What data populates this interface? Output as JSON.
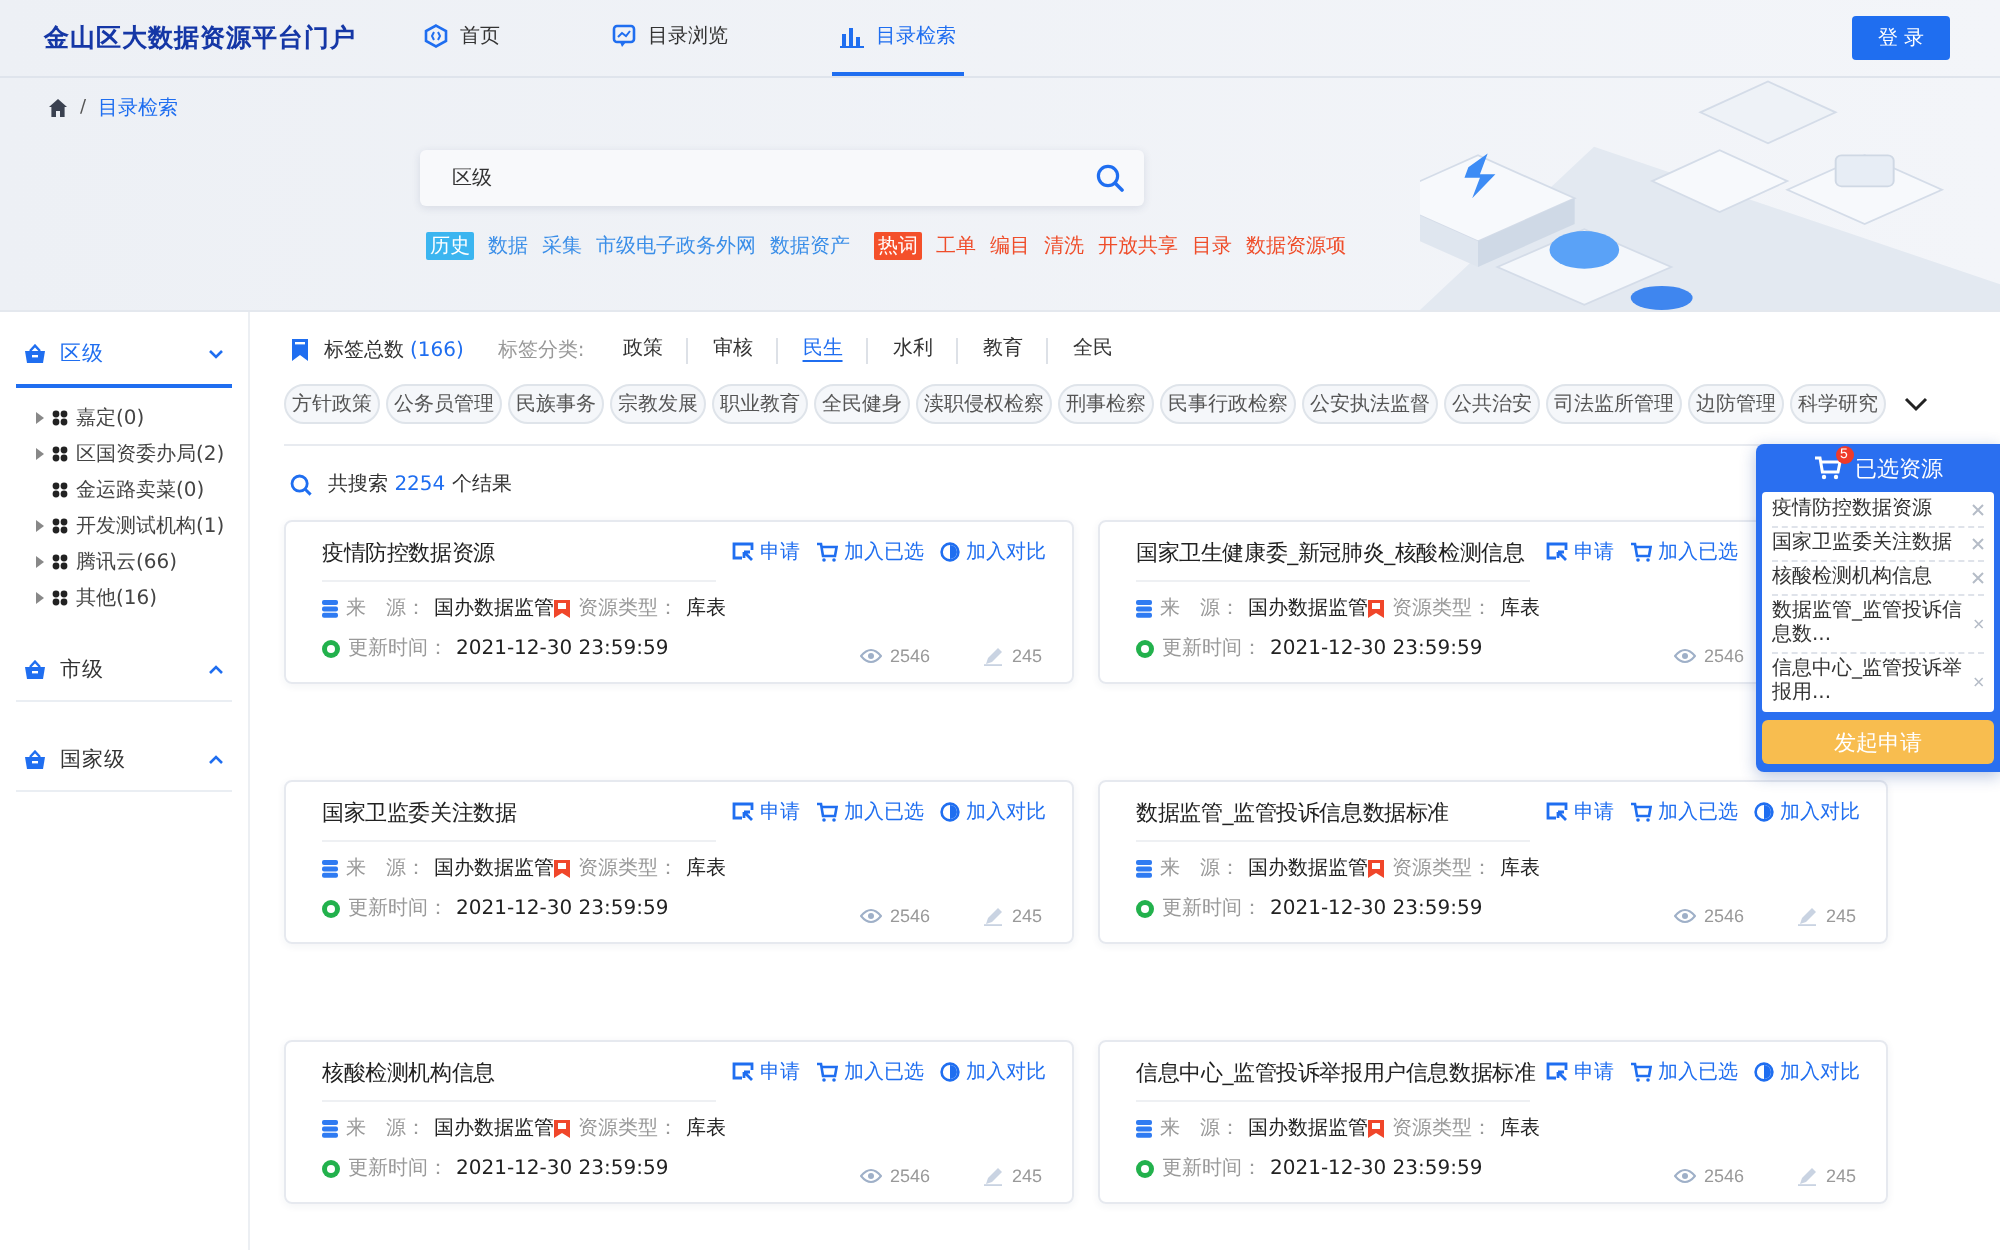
{
  "header": {
    "title": "金山区大数据资源平台门户",
    "nav": [
      {
        "kind": "home",
        "label": "首页",
        "selected": false
      },
      {
        "kind": "browse",
        "label": "目录浏览",
        "selected": false
      },
      {
        "kind": "search",
        "label": "目录检索",
        "selected": true
      }
    ],
    "login": "登 录"
  },
  "breadcrumb": {
    "separator": "/",
    "current": "目录检索"
  },
  "search": {
    "value": "区级"
  },
  "keywords": [
    {
      "kind": "history",
      "label": "历史",
      "items": [
        "数据",
        "采集",
        "市级电子政务外网",
        "数据资产"
      ]
    },
    {
      "kind": "hot",
      "label": "热词",
      "items": [
        "工单",
        "编目",
        "清洗",
        "开放共享",
        "目录",
        "数据资源项"
      ]
    }
  ],
  "sidebar": [
    {
      "label": "区级",
      "selected": true,
      "expanded": true,
      "children": [
        {
          "label": "嘉定(0)",
          "expandable": true
        },
        {
          "label": "区国资委办局(2)",
          "expandable": true
        },
        {
          "label": "金运路卖菜(0)",
          "expandable": false
        },
        {
          "label": "开发测试机构(1)",
          "expandable": true
        },
        {
          "label": "腾讯云(66)",
          "expandable": true
        },
        {
          "label": "其他(16)",
          "expandable": true
        }
      ]
    },
    {
      "label": "市级",
      "selected": false,
      "expanded": false
    },
    {
      "label": "国家级",
      "selected": false,
      "expanded": false
    }
  ],
  "tags": {
    "total_label": "标签总数",
    "total": "(166)",
    "category_label": "标签分类:",
    "categories": [
      {
        "label": "政策",
        "selected": false
      },
      {
        "label": "审核",
        "selected": false
      },
      {
        "label": "民生",
        "selected": true
      },
      {
        "label": "水利",
        "selected": false
      },
      {
        "label": "教育",
        "selected": false
      },
      {
        "label": "全民",
        "selected": false
      }
    ],
    "chips": [
      "方针政策",
      "公务员管理",
      "民族事务",
      "宗教发展",
      "职业教育",
      "全民健身",
      "渎职侵权检察",
      "刑事检察",
      "民事行政检察",
      "公安执法监督",
      "公共治安",
      "司法监所管理",
      "边防管理",
      "科学研究"
    ],
    "chips_expanded": false
  },
  "results": {
    "prefix": "共搜索",
    "count": "2254",
    "suffix": "个结果"
  },
  "cards": [
    {
      "title": "疫情防控数据资源",
      "actions": [
        {
          "kind": "apply",
          "label": "申请"
        },
        {
          "kind": "cart",
          "label": "加入已选"
        },
        {
          "kind": "compare",
          "label": "加入对比"
        }
      ],
      "source_label": "来　源：",
      "source": "国办数据监管",
      "type_label": "资源类型：",
      "type": "库表",
      "updated_label": "更新时间：",
      "updated": "2021-12-30 23:59:59",
      "stats": [
        {
          "kind": "views",
          "value": "2546"
        },
        {
          "kind": "edits",
          "value": "245"
        }
      ]
    },
    {
      "title": "国家卫生健康委_新冠肺炎_核酸检测信息",
      "actions": [
        {
          "kind": "apply",
          "label": "申请"
        },
        {
          "kind": "cart",
          "label": "加入已选"
        }
      ],
      "source_label": "来　源：",
      "source": "国办数据监管",
      "type_label": "资源类型：",
      "type": "库表",
      "updated_label": "更新时间：",
      "updated": "2021-12-30 23:59:59",
      "stats": [
        {
          "kind": "views",
          "value": "2546"
        }
      ]
    },
    {
      "title": "国家卫监委关注数据",
      "actions": [
        {
          "kind": "apply",
          "label": "申请"
        },
        {
          "kind": "cart",
          "label": "加入已选"
        },
        {
          "kind": "compare",
          "label": "加入对比"
        }
      ],
      "source_label": "来　源：",
      "source": "国办数据监管",
      "type_label": "资源类型：",
      "type": "库表",
      "updated_label": "更新时间：",
      "updated": "2021-12-30 23:59:59",
      "stats": [
        {
          "kind": "views",
          "value": "2546"
        },
        {
          "kind": "edits",
          "value": "245"
        }
      ]
    },
    {
      "title": "数据监管_监管投诉信息数据标准",
      "actions": [
        {
          "kind": "apply",
          "label": "申请"
        },
        {
          "kind": "cart",
          "label": "加入已选"
        },
        {
          "kind": "compare",
          "label": "加入对比"
        }
      ],
      "source_label": "来　源：",
      "source": "国办数据监管",
      "type_label": "资源类型：",
      "type": "库表",
      "updated_label": "更新时间：",
      "updated": "2021-12-30 23:59:59",
      "stats": [
        {
          "kind": "views",
          "value": "2546"
        },
        {
          "kind": "edits",
          "value": "245"
        }
      ]
    },
    {
      "title": "核酸检测机构信息",
      "actions": [
        {
          "kind": "apply",
          "label": "申请"
        },
        {
          "kind": "cart",
          "label": "加入已选"
        },
        {
          "kind": "compare",
          "label": "加入对比"
        }
      ],
      "source_label": "来　源：",
      "source": "国办数据监管",
      "type_label": "资源类型：",
      "type": "库表",
      "updated_label": "更新时间：",
      "updated": "2021-12-30 23:59:59",
      "stats": [
        {
          "kind": "views",
          "value": "2546"
        },
        {
          "kind": "edits",
          "value": "245"
        }
      ]
    },
    {
      "title": "信息中心_监管投诉举报用户信息数据标准",
      "actions": [
        {
          "kind": "apply",
          "label": "申请"
        },
        {
          "kind": "cart",
          "label": "加入已选"
        },
        {
          "kind": "compare",
          "label": "加入对比"
        }
      ],
      "source_label": "来　源：",
      "source": "国办数据监管",
      "type_label": "资源类型：",
      "type": "库表",
      "updated_label": "更新时间：",
      "updated": "2021-12-30 23:59:59",
      "stats": [
        {
          "kind": "views",
          "value": "2546"
        },
        {
          "kind": "edits",
          "value": "245"
        }
      ]
    }
  ],
  "cart": {
    "title": "已选资源",
    "badge": "5",
    "items": [
      "疫情防控数据资源",
      "国家卫监委关注数据",
      "核酸检测机构信息",
      "数据监管_监管投诉信息数...",
      "信息中心_监管投诉举报用..."
    ],
    "submit": "发起申请"
  }
}
